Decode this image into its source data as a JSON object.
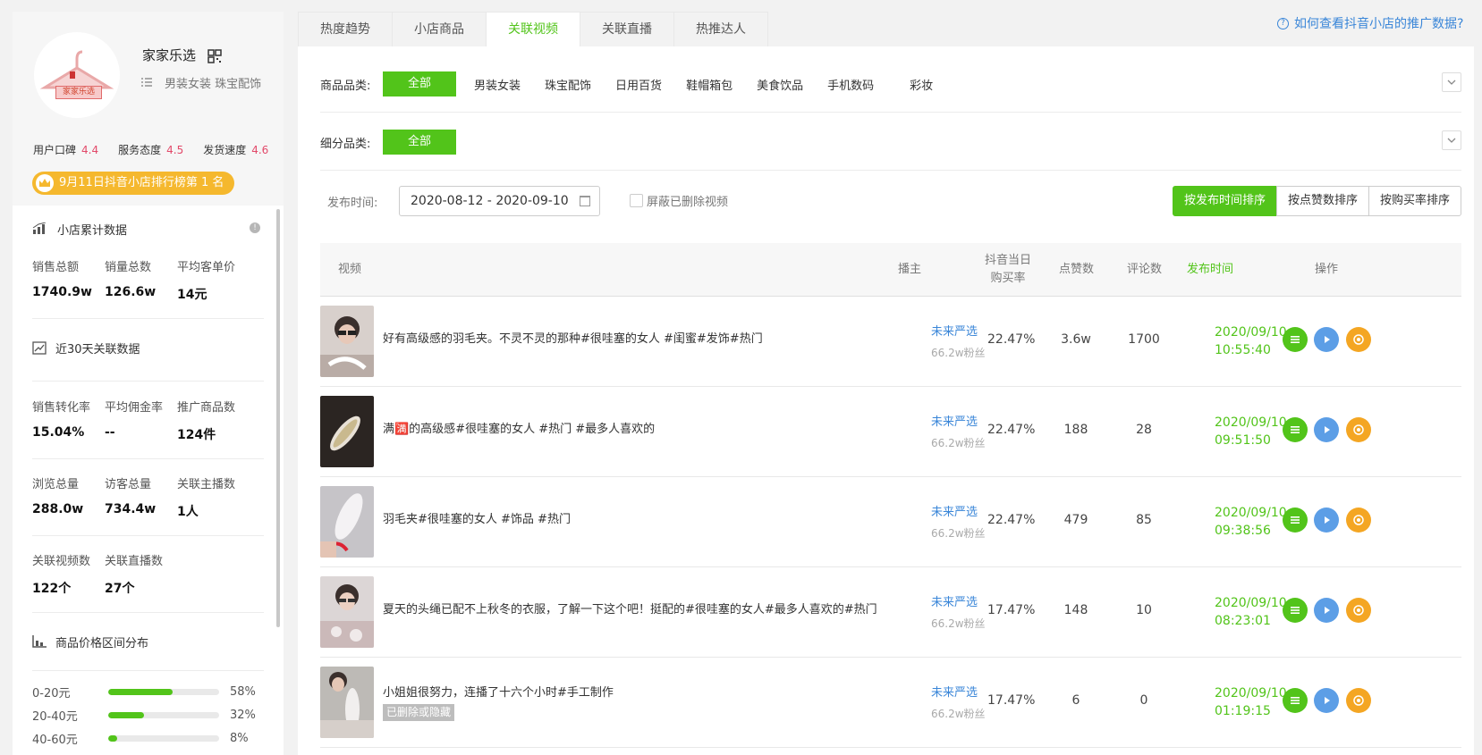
{
  "shop": {
    "name": "家家乐选",
    "logo_text": "家家乐选",
    "category": "男装女装 珠宝配饰",
    "ratings": [
      {
        "label": "用户口碑",
        "value": "4.4"
      },
      {
        "label": "服务态度",
        "value": "4.5"
      },
      {
        "label": "发货速度",
        "value": "4.6"
      }
    ],
    "rank_text": "9月11日抖音小店排行榜第 1 名"
  },
  "stats": {
    "cumulative_title": "小店累计数据",
    "cumulative": [
      {
        "label": "销售总额",
        "value": "1740.9w"
      },
      {
        "label": "销量总数",
        "value": "126.6w"
      },
      {
        "label": "平均客单价",
        "value": "14元"
      }
    ],
    "recent_title": "近30天关联数据",
    "recent_row1": [
      {
        "label": "销售转化率",
        "value": "15.04%"
      },
      {
        "label": "平均佣金率",
        "value": "--"
      },
      {
        "label": "推广商品数",
        "value": "124件"
      }
    ],
    "recent_row2": [
      {
        "label": "浏览总量",
        "value": "288.0w"
      },
      {
        "label": "访客总量",
        "value": "734.4w"
      },
      {
        "label": "关联主播数",
        "value": "1人"
      }
    ],
    "recent_row3": [
      {
        "label": "关联视频数",
        "value": "122个"
      },
      {
        "label": "关联直播数",
        "value": "27个"
      }
    ],
    "price_title": "商品价格区间分布",
    "price_dist": [
      {
        "label": "0-20元",
        "percent": 58,
        "text": "58%"
      },
      {
        "label": "20-40元",
        "percent": 32,
        "text": "32%"
      },
      {
        "label": "40-60元",
        "percent": 8,
        "text": "8%"
      }
    ]
  },
  "tabs": [
    "热度趋势",
    "小店商品",
    "关联视频",
    "关联直播",
    "热推达人"
  ],
  "active_tab": 2,
  "help_link": "如何查看抖音小店的推广数据?",
  "filters": {
    "category_label": "商品品类:",
    "all_label": "全部",
    "categories": [
      "男装女装",
      "珠宝配饰",
      "日用百货",
      "鞋帽箱包",
      "美食饮品",
      "手机数码",
      "彩妆"
    ],
    "sub_label": "细分品类:",
    "sub_all_label": "全部"
  },
  "date": {
    "label": "发布时间:",
    "range": "2020-08-12 - 2020-09-10",
    "hide_deleted": "屏蔽已删除视频"
  },
  "sort": {
    "by_time": "按发布时间排序",
    "by_likes": "按点赞数排序",
    "by_buy_rate": "按购买率排序"
  },
  "table": {
    "headers": {
      "video": "视频",
      "host": "播主",
      "buy_rate": "抖音当日",
      "buy_rate2": "购买率",
      "likes": "点赞数",
      "comments": "评论数",
      "publish_time": "发布时间",
      "actions": "操作"
    },
    "rows": [
      {
        "title": "好有高级感的羽毛夹。不灵不灵的那种#很哇塞的女人 #闺蜜#发饰#热门",
        "host": "未来严选",
        "fans": "66.2w粉丝",
        "buy_rate": "22.47%",
        "likes": "3.6w",
        "comments": "1700",
        "date": "2020/09/10",
        "time": "10:55:40",
        "deleted": ""
      },
      {
        "title": "满🈵的高级感#很哇塞的女人 #热门 #最多人喜欢的",
        "host": "未来严选",
        "fans": "66.2w粉丝",
        "buy_rate": "22.47%",
        "likes": "188",
        "comments": "28",
        "date": "2020/09/10",
        "time": "09:51:50",
        "deleted": ""
      },
      {
        "title": "羽毛夹#很哇塞的女人 #饰品 #热门",
        "host": "未来严选",
        "fans": "66.2w粉丝",
        "buy_rate": "22.47%",
        "likes": "479",
        "comments": "85",
        "date": "2020/09/10",
        "time": "09:38:56",
        "deleted": ""
      },
      {
        "title": "夏天的头绳已配不上秋冬的衣服，了解一下这个吧！挺配的#很哇塞的女人#最多人喜欢的#热门",
        "host": "未来严选",
        "fans": "66.2w粉丝",
        "buy_rate": "17.47%",
        "likes": "148",
        "comments": "10",
        "date": "2020/09/10",
        "time": "08:23:01",
        "deleted": ""
      },
      {
        "title": "小姐姐很努力，连播了十六个小时#手工制作",
        "host": "未来严选",
        "fans": "66.2w粉丝",
        "buy_rate": "17.47%",
        "likes": "6",
        "comments": "0",
        "date": "2020/09/10",
        "time": "01:19:15",
        "deleted": "已删除或隐藏"
      }
    ]
  },
  "colors": {
    "accent_green": "#52c41a",
    "link_blue": "#3a86d8",
    "rating_red": "#e24a6a",
    "rank_gold": "#f5b82e"
  }
}
